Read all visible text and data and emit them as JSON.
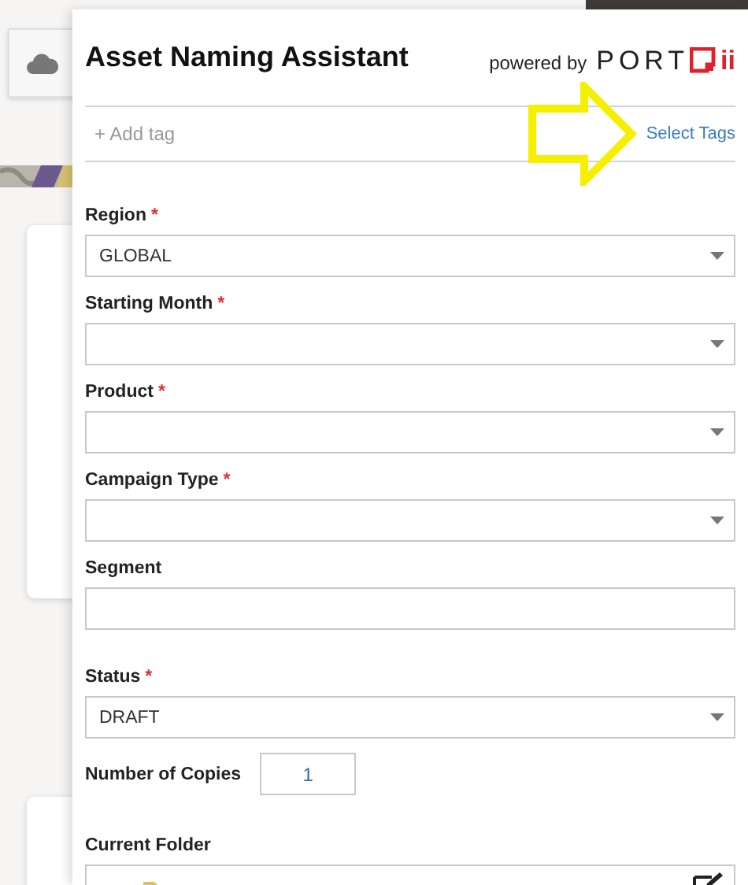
{
  "panel": {
    "title": "Asset Naming Assistant",
    "powered_by": "powered by",
    "logo": {
      "left": "PORT",
      "right": "ii"
    }
  },
  "tags": {
    "add": "+ Add tag",
    "select": "Select Tags"
  },
  "fields": [
    {
      "kind": "select",
      "label": "Region",
      "required_mark": "*",
      "value": "GLOBAL"
    },
    {
      "kind": "select",
      "label": "Starting Month",
      "required_mark": "*"
    },
    {
      "kind": "select",
      "label": "Product",
      "required_mark": "*"
    },
    {
      "kind": "select",
      "label": "Campaign Type",
      "required_mark": "*"
    },
    {
      "kind": "text",
      "label": "Segment"
    },
    {
      "kind": "select",
      "label": "Status",
      "required_mark": "*",
      "value": "DRAFT"
    }
  ],
  "copies": {
    "label": "Number of Copies",
    "value": "1"
  },
  "folder": {
    "label": "Current Folder"
  }
}
